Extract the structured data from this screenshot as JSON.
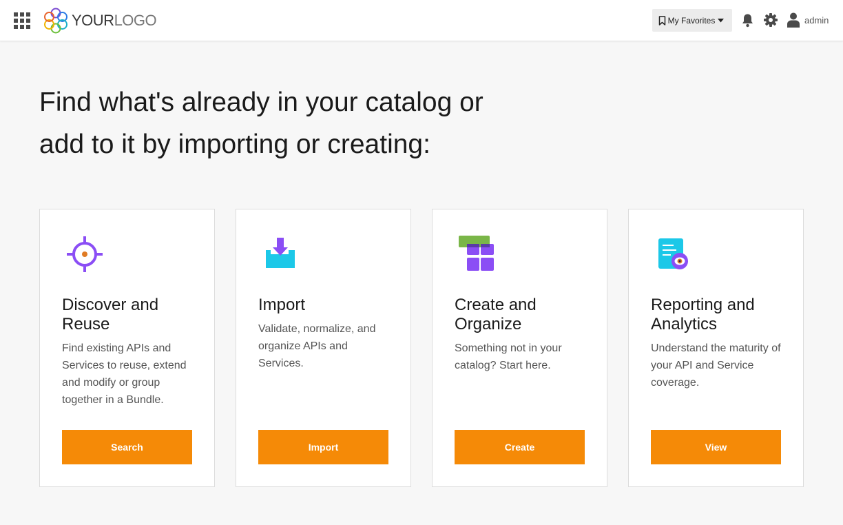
{
  "header": {
    "logo": {
      "part1": "YOUR",
      "part2": "LOGO"
    },
    "favorites_label": "My Favorites",
    "user_name": "admin",
    "icons": {
      "apps": "apps-grid-icon",
      "bookmark": "bookmark-icon",
      "bell": "bell-icon",
      "settings": "gear-icon",
      "user": "user-icon"
    }
  },
  "main": {
    "headline_line1": "Find what's already in your catalog or",
    "headline_line2": "add to it by importing or creating:",
    "cards": [
      {
        "title": "Discover and Reuse",
        "description": "Find existing APIs and Services to reuse, extend and modify or group together in a Bundle.",
        "button": "Search",
        "icon": "crosshair-icon"
      },
      {
        "title": "Import",
        "description": "Validate, normalize, and organize APIs and Services.",
        "button": "Import",
        "icon": "import-tray-icon"
      },
      {
        "title": "Create and Organize",
        "description": "Something not in your catalog? Start here.",
        "button": "Create",
        "icon": "grid-blocks-icon"
      },
      {
        "title": "Reporting and Analytics",
        "description": "Understand the maturity of your API and Service coverage.",
        "button": "View",
        "icon": "report-eye-icon"
      }
    ]
  },
  "colors": {
    "accent_orange": "#f58a07",
    "icon_purple": "#8b4ef5",
    "icon_cyan": "#1cc8e8",
    "icon_green": "#7ab648",
    "icon_orange_dot": "#e07b24"
  }
}
